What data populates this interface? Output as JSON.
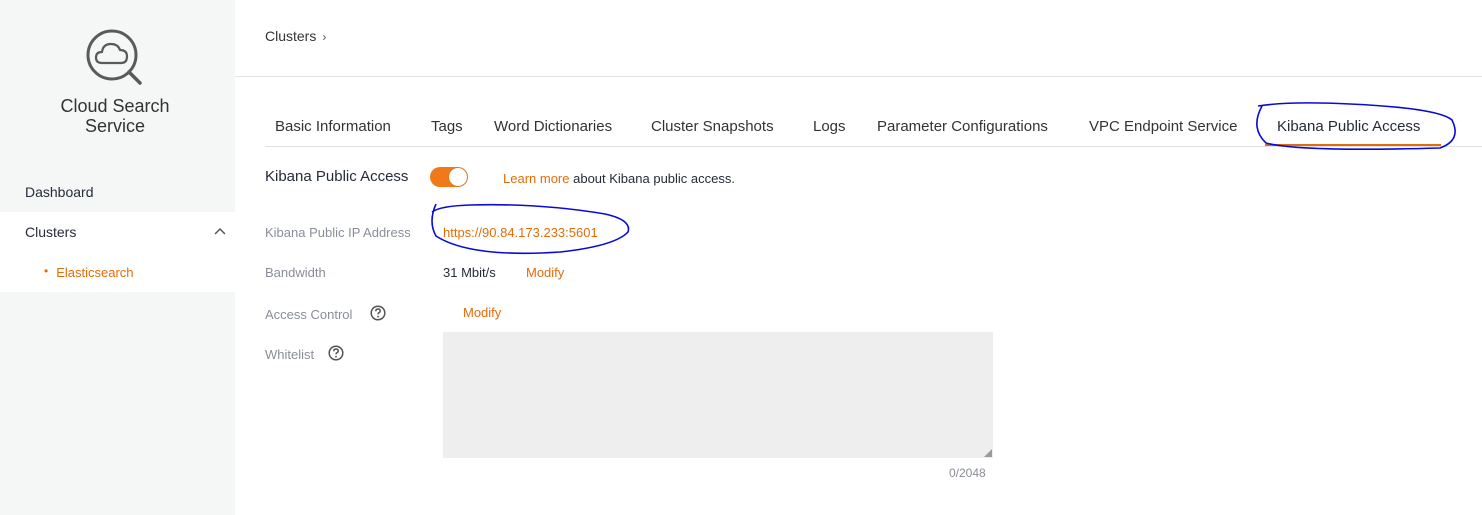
{
  "sidebar": {
    "app_title_line1": "Cloud Search",
    "app_title_line2": "Service",
    "logo_icon": "cloud-search-icon",
    "nav": {
      "dashboard": "Dashboard",
      "clusters": "Clusters",
      "elasticsearch": "Elasticsearch",
      "bullet": "•"
    }
  },
  "breadcrumb": {
    "item": "Clusters",
    "separator": "›"
  },
  "tabs": [
    {
      "label": "Basic Information"
    },
    {
      "label": "Tags"
    },
    {
      "label": "Word Dictionaries"
    },
    {
      "label": "Cluster Snapshots"
    },
    {
      "label": "Logs"
    },
    {
      "label": "Parameter Configurations"
    },
    {
      "label": "VPC Endpoint Service"
    },
    {
      "label": "Kibana Public Access"
    }
  ],
  "kibana": {
    "label": "Kibana Public Access",
    "toggle_on": true,
    "learn_more": "Learn more",
    "learn_more_suffix": "about Kibana public access.",
    "ip_label": "Kibana Public IP Address",
    "ip_value": "https://90.84.173.233:5601",
    "bandwidth_label": "Bandwidth",
    "bandwidth_value": "31 Mbit/s",
    "bandwidth_modify": "Modify",
    "access_control_label": "Access Control",
    "access_control_modify": "Modify",
    "whitelist_label": "Whitelist",
    "whitelist_value": "",
    "whitelist_counter": "0/2048"
  },
  "colors": {
    "accent": "#e36c0a",
    "annotation": "#0000cc",
    "sidebar_bg": "#f5f6f6"
  }
}
